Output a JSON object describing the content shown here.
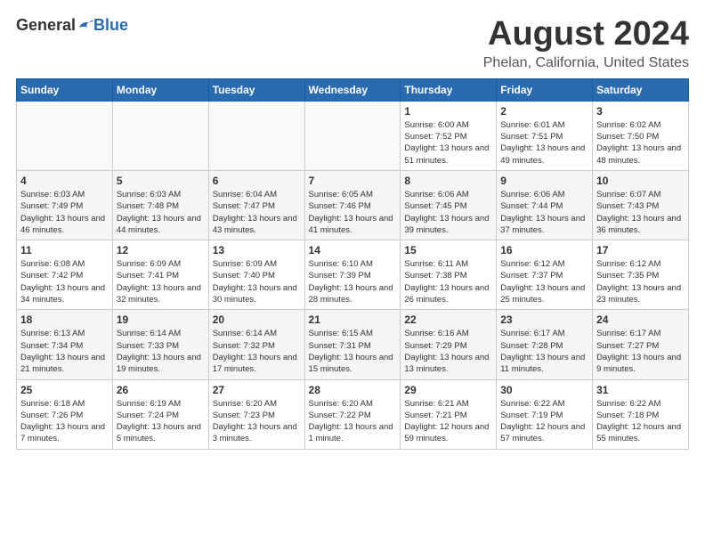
{
  "header": {
    "logo_general": "General",
    "logo_blue": "Blue",
    "title": "August 2024",
    "subtitle": "Phelan, California, United States"
  },
  "weekdays": [
    "Sunday",
    "Monday",
    "Tuesday",
    "Wednesday",
    "Thursday",
    "Friday",
    "Saturday"
  ],
  "weeks": [
    [
      {
        "day": "",
        "sunrise": "",
        "sunset": "",
        "daylight": ""
      },
      {
        "day": "",
        "sunrise": "",
        "sunset": "",
        "daylight": ""
      },
      {
        "day": "",
        "sunrise": "",
        "sunset": "",
        "daylight": ""
      },
      {
        "day": "",
        "sunrise": "",
        "sunset": "",
        "daylight": ""
      },
      {
        "day": "1",
        "sunrise": "Sunrise: 6:00 AM",
        "sunset": "Sunset: 7:52 PM",
        "daylight": "Daylight: 13 hours and 51 minutes."
      },
      {
        "day": "2",
        "sunrise": "Sunrise: 6:01 AM",
        "sunset": "Sunset: 7:51 PM",
        "daylight": "Daylight: 13 hours and 49 minutes."
      },
      {
        "day": "3",
        "sunrise": "Sunrise: 6:02 AM",
        "sunset": "Sunset: 7:50 PM",
        "daylight": "Daylight: 13 hours and 48 minutes."
      }
    ],
    [
      {
        "day": "4",
        "sunrise": "Sunrise: 6:03 AM",
        "sunset": "Sunset: 7:49 PM",
        "daylight": "Daylight: 13 hours and 46 minutes."
      },
      {
        "day": "5",
        "sunrise": "Sunrise: 6:03 AM",
        "sunset": "Sunset: 7:48 PM",
        "daylight": "Daylight: 13 hours and 44 minutes."
      },
      {
        "day": "6",
        "sunrise": "Sunrise: 6:04 AM",
        "sunset": "Sunset: 7:47 PM",
        "daylight": "Daylight: 13 hours and 43 minutes."
      },
      {
        "day": "7",
        "sunrise": "Sunrise: 6:05 AM",
        "sunset": "Sunset: 7:46 PM",
        "daylight": "Daylight: 13 hours and 41 minutes."
      },
      {
        "day": "8",
        "sunrise": "Sunrise: 6:06 AM",
        "sunset": "Sunset: 7:45 PM",
        "daylight": "Daylight: 13 hours and 39 minutes."
      },
      {
        "day": "9",
        "sunrise": "Sunrise: 6:06 AM",
        "sunset": "Sunset: 7:44 PM",
        "daylight": "Daylight: 13 hours and 37 minutes."
      },
      {
        "day": "10",
        "sunrise": "Sunrise: 6:07 AM",
        "sunset": "Sunset: 7:43 PM",
        "daylight": "Daylight: 13 hours and 36 minutes."
      }
    ],
    [
      {
        "day": "11",
        "sunrise": "Sunrise: 6:08 AM",
        "sunset": "Sunset: 7:42 PM",
        "daylight": "Daylight: 13 hours and 34 minutes."
      },
      {
        "day": "12",
        "sunrise": "Sunrise: 6:09 AM",
        "sunset": "Sunset: 7:41 PM",
        "daylight": "Daylight: 13 hours and 32 minutes."
      },
      {
        "day": "13",
        "sunrise": "Sunrise: 6:09 AM",
        "sunset": "Sunset: 7:40 PM",
        "daylight": "Daylight: 13 hours and 30 minutes."
      },
      {
        "day": "14",
        "sunrise": "Sunrise: 6:10 AM",
        "sunset": "Sunset: 7:39 PM",
        "daylight": "Daylight: 13 hours and 28 minutes."
      },
      {
        "day": "15",
        "sunrise": "Sunrise: 6:11 AM",
        "sunset": "Sunset: 7:38 PM",
        "daylight": "Daylight: 13 hours and 26 minutes."
      },
      {
        "day": "16",
        "sunrise": "Sunrise: 6:12 AM",
        "sunset": "Sunset: 7:37 PM",
        "daylight": "Daylight: 13 hours and 25 minutes."
      },
      {
        "day": "17",
        "sunrise": "Sunrise: 6:12 AM",
        "sunset": "Sunset: 7:35 PM",
        "daylight": "Daylight: 13 hours and 23 minutes."
      }
    ],
    [
      {
        "day": "18",
        "sunrise": "Sunrise: 6:13 AM",
        "sunset": "Sunset: 7:34 PM",
        "daylight": "Daylight: 13 hours and 21 minutes."
      },
      {
        "day": "19",
        "sunrise": "Sunrise: 6:14 AM",
        "sunset": "Sunset: 7:33 PM",
        "daylight": "Daylight: 13 hours and 19 minutes."
      },
      {
        "day": "20",
        "sunrise": "Sunrise: 6:14 AM",
        "sunset": "Sunset: 7:32 PM",
        "daylight": "Daylight: 13 hours and 17 minutes."
      },
      {
        "day": "21",
        "sunrise": "Sunrise: 6:15 AM",
        "sunset": "Sunset: 7:31 PM",
        "daylight": "Daylight: 13 hours and 15 minutes."
      },
      {
        "day": "22",
        "sunrise": "Sunrise: 6:16 AM",
        "sunset": "Sunset: 7:29 PM",
        "daylight": "Daylight: 13 hours and 13 minutes."
      },
      {
        "day": "23",
        "sunrise": "Sunrise: 6:17 AM",
        "sunset": "Sunset: 7:28 PM",
        "daylight": "Daylight: 13 hours and 11 minutes."
      },
      {
        "day": "24",
        "sunrise": "Sunrise: 6:17 AM",
        "sunset": "Sunset: 7:27 PM",
        "daylight": "Daylight: 13 hours and 9 minutes."
      }
    ],
    [
      {
        "day": "25",
        "sunrise": "Sunrise: 6:18 AM",
        "sunset": "Sunset: 7:26 PM",
        "daylight": "Daylight: 13 hours and 7 minutes."
      },
      {
        "day": "26",
        "sunrise": "Sunrise: 6:19 AM",
        "sunset": "Sunset: 7:24 PM",
        "daylight": "Daylight: 13 hours and 5 minutes."
      },
      {
        "day": "27",
        "sunrise": "Sunrise: 6:20 AM",
        "sunset": "Sunset: 7:23 PM",
        "daylight": "Daylight: 13 hours and 3 minutes."
      },
      {
        "day": "28",
        "sunrise": "Sunrise: 6:20 AM",
        "sunset": "Sunset: 7:22 PM",
        "daylight": "Daylight: 13 hours and 1 minute."
      },
      {
        "day": "29",
        "sunrise": "Sunrise: 6:21 AM",
        "sunset": "Sunset: 7:21 PM",
        "daylight": "Daylight: 12 hours and 59 minutes."
      },
      {
        "day": "30",
        "sunrise": "Sunrise: 6:22 AM",
        "sunset": "Sunset: 7:19 PM",
        "daylight": "Daylight: 12 hours and 57 minutes."
      },
      {
        "day": "31",
        "sunrise": "Sunrise: 6:22 AM",
        "sunset": "Sunset: 7:18 PM",
        "daylight": "Daylight: 12 hours and 55 minutes."
      }
    ]
  ]
}
